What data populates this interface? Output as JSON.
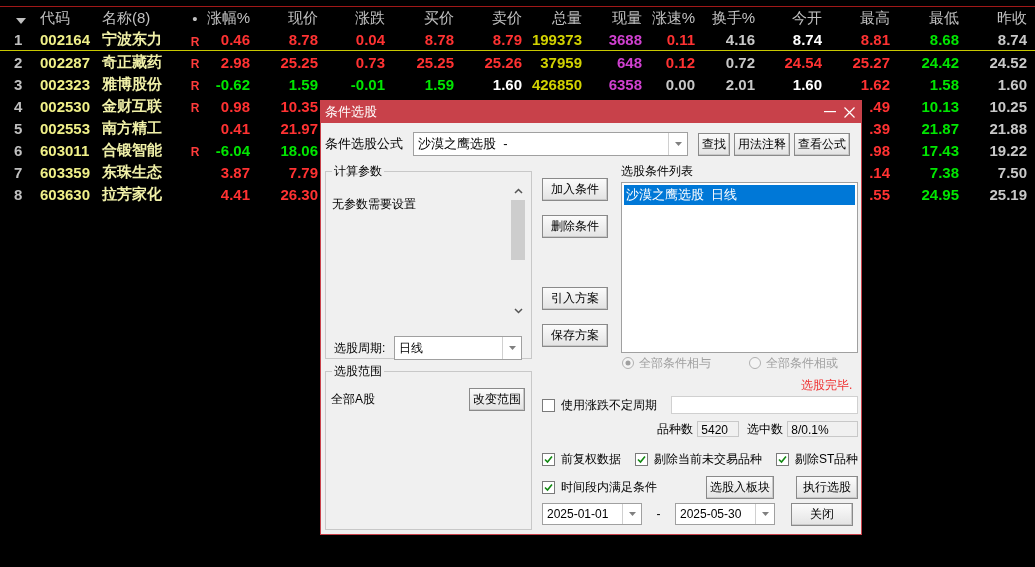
{
  "table": {
    "columns": [
      "代码",
      "名称(8)",
      "•",
      "涨幅%",
      "现价",
      "涨跌",
      "买价",
      "卖价",
      "总量",
      "现量",
      "涨速%",
      "换手%",
      "今开",
      "最高",
      "最低",
      "昨收"
    ],
    "rows": [
      {
        "number": "1",
        "selected": true,
        "cells": [
          {
            "text": "002164",
            "kind": "code"
          },
          {
            "text": "宁波东力",
            "kind": "name"
          },
          {
            "text": "R",
            "kind": "flag"
          },
          {
            "text": "0.46",
            "kind": "up"
          },
          {
            "text": "8.78",
            "kind": "up"
          },
          {
            "text": "0.04",
            "kind": "up"
          },
          {
            "text": "8.78",
            "kind": "up"
          },
          {
            "text": "8.79",
            "kind": "up"
          },
          {
            "text": "199373",
            "kind": "volume"
          },
          {
            "text": "3688",
            "kind": "current"
          },
          {
            "text": "0.11",
            "kind": "up"
          },
          {
            "text": "4.16",
            "kind": "plain"
          },
          {
            "text": "8.74",
            "kind": "flat"
          },
          {
            "text": "8.81",
            "kind": "up"
          },
          {
            "text": "8.68",
            "kind": "down"
          },
          {
            "text": "8.74",
            "kind": "plain"
          }
        ]
      },
      {
        "number": "2",
        "selected": false,
        "cells": [
          {
            "text": "002287",
            "kind": "code"
          },
          {
            "text": "奇正藏药",
            "kind": "name"
          },
          {
            "text": "R",
            "kind": "flag"
          },
          {
            "text": "2.98",
            "kind": "up"
          },
          {
            "text": "25.25",
            "kind": "up"
          },
          {
            "text": "0.73",
            "kind": "up"
          },
          {
            "text": "25.25",
            "kind": "up"
          },
          {
            "text": "25.26",
            "kind": "up"
          },
          {
            "text": "37959",
            "kind": "volume"
          },
          {
            "text": "648",
            "kind": "current"
          },
          {
            "text": "0.12",
            "kind": "up"
          },
          {
            "text": "0.72",
            "kind": "plain"
          },
          {
            "text": "24.54",
            "kind": "up"
          },
          {
            "text": "25.27",
            "kind": "up"
          },
          {
            "text": "24.42",
            "kind": "down"
          },
          {
            "text": "24.52",
            "kind": "plain"
          }
        ]
      },
      {
        "number": "3",
        "selected": false,
        "cells": [
          {
            "text": "002323",
            "kind": "code"
          },
          {
            "text": "雅博股份",
            "kind": "name"
          },
          {
            "text": "R",
            "kind": "flag"
          },
          {
            "text": "-0.62",
            "kind": "down"
          },
          {
            "text": "1.59",
            "kind": "down"
          },
          {
            "text": "-0.01",
            "kind": "down"
          },
          {
            "text": "1.59",
            "kind": "down"
          },
          {
            "text": "1.60",
            "kind": "flat"
          },
          {
            "text": "426850",
            "kind": "volume"
          },
          {
            "text": "6358",
            "kind": "current"
          },
          {
            "text": "0.00",
            "kind": "plain"
          },
          {
            "text": "2.01",
            "kind": "plain"
          },
          {
            "text": "1.60",
            "kind": "flat"
          },
          {
            "text": "1.62",
            "kind": "up"
          },
          {
            "text": "1.58",
            "kind": "down"
          },
          {
            "text": "1.60",
            "kind": "plain"
          }
        ]
      },
      {
        "number": "4",
        "selected": false,
        "cells": [
          {
            "text": "002530",
            "kind": "code"
          },
          {
            "text": "金财互联",
            "kind": "name"
          },
          {
            "text": "R",
            "kind": "flag"
          },
          {
            "text": "0.98",
            "kind": "up"
          },
          {
            "text": "10.35",
            "kind": "up"
          },
          null,
          null,
          null,
          null,
          null,
          null,
          null,
          null,
          {
            "text": ".49",
            "kind": "up"
          },
          {
            "text": "10.13",
            "kind": "down"
          },
          {
            "text": "10.25",
            "kind": "plain"
          }
        ]
      },
      {
        "number": "5",
        "selected": false,
        "cells": [
          {
            "text": "002553",
            "kind": "code"
          },
          {
            "text": "南方精工",
            "kind": "name"
          },
          null,
          {
            "text": "0.41",
            "kind": "up"
          },
          {
            "text": "21.97",
            "kind": "up"
          },
          null,
          null,
          null,
          null,
          null,
          null,
          null,
          null,
          {
            "text": ".39",
            "kind": "up"
          },
          {
            "text": "21.87",
            "kind": "down"
          },
          {
            "text": "21.88",
            "kind": "plain"
          }
        ]
      },
      {
        "number": "6",
        "selected": false,
        "cells": [
          {
            "text": "603011",
            "kind": "code"
          },
          {
            "text": "合锻智能",
            "kind": "name"
          },
          {
            "text": "R",
            "kind": "flag"
          },
          {
            "text": "-6.04",
            "kind": "down"
          },
          {
            "text": "18.06",
            "kind": "down"
          },
          null,
          null,
          null,
          null,
          null,
          null,
          null,
          null,
          {
            "text": ".98",
            "kind": "up"
          },
          {
            "text": "17.43",
            "kind": "down"
          },
          {
            "text": "19.22",
            "kind": "plain"
          }
        ]
      },
      {
        "number": "7",
        "selected": false,
        "cells": [
          {
            "text": "603359",
            "kind": "code"
          },
          {
            "text": "东珠生态",
            "kind": "name"
          },
          null,
          {
            "text": "3.87",
            "kind": "up"
          },
          {
            "text": "7.79",
            "kind": "up"
          },
          null,
          null,
          null,
          null,
          null,
          null,
          null,
          null,
          {
            "text": ".14",
            "kind": "up"
          },
          {
            "text": "7.38",
            "kind": "down"
          },
          {
            "text": "7.50",
            "kind": "plain"
          }
        ]
      },
      {
        "number": "8",
        "selected": false,
        "cells": [
          {
            "text": "603630",
            "kind": "code"
          },
          {
            "text": "拉芳家化",
            "kind": "name"
          },
          null,
          {
            "text": "4.41",
            "kind": "up"
          },
          {
            "text": "26.30",
            "kind": "up"
          },
          null,
          null,
          null,
          null,
          null,
          null,
          null,
          null,
          {
            "text": ".55",
            "kind": "up"
          },
          {
            "text": "24.95",
            "kind": "down"
          },
          {
            "text": "25.19",
            "kind": "plain"
          }
        ]
      }
    ]
  },
  "dialog": {
    "title": "条件选股",
    "formula": {
      "label": "条件选股公式",
      "value": "沙漠之鹰选股  -"
    },
    "formula_buttons": [
      "查找",
      "用法注释",
      "查看公式"
    ],
    "parameters": {
      "title": "计算参数",
      "text": "无参数需要设置",
      "period_label": "选股周期:",
      "period_value": "日线"
    },
    "condition_buttons": [
      "加入条件",
      "删除条件",
      "引入方案",
      "保存方案"
    ],
    "condition_list": {
      "title": "选股条件列表",
      "items": [
        {
          "text": "沙漠之鹰选股  日线",
          "selected": true
        }
      ]
    },
    "logic_options": [
      {
        "label": "全部条件相与",
        "selected": true,
        "disabled": true
      },
      {
        "label": "全部条件相或",
        "selected": false,
        "disabled": true
      }
    ],
    "status": "选股完毕.",
    "scope": {
      "title": "选股范围",
      "value": "全部A股",
      "button": "改变范围"
    },
    "variable_period": {
      "label": "使用涨跌不定周期",
      "checked": false
    },
    "counts": [
      {
        "label": "品种数",
        "value": "5420"
      },
      {
        "label": "选中数",
        "value": "8/0.1%"
      }
    ],
    "options": [
      {
        "label": "前复权数据",
        "checked": true
      },
      {
        "label": "剔除当前未交易品种",
        "checked": true
      },
      {
        "label": "剔除ST品种",
        "checked": true
      }
    ],
    "time_range": {
      "label": "时间段内满足条件",
      "checked": true,
      "start": "2025-01-01",
      "separator": "-",
      "end": "2025-05-30"
    },
    "action_buttons": [
      "选股入板块",
      "执行选股",
      "关闭"
    ]
  }
}
